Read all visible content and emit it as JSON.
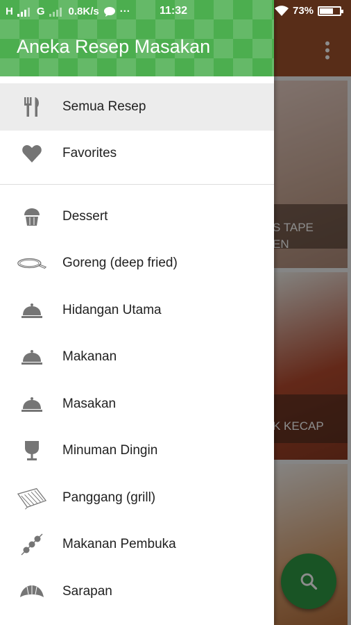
{
  "status_bar": {
    "network": "H",
    "network2": "G",
    "speed": "0.8K/s",
    "more": "···",
    "time": "11:32",
    "battery_level": "73%",
    "battery_fraction": 0.73
  },
  "app": {
    "title": "Aneka Resep Masakan"
  },
  "menu_primary": [
    {
      "label": "Semua Resep",
      "icon": "cutlery-icon"
    },
    {
      "label": "Favorites",
      "icon": "heart-icon"
    }
  ],
  "menu_categories": [
    {
      "label": "Dessert",
      "icon": "cupcake-icon"
    },
    {
      "label": "Goreng (deep fried)",
      "icon": "frying-pan-icon"
    },
    {
      "label": "Hidangan Utama",
      "icon": "cloche-icon"
    },
    {
      "label": "Makanan",
      "icon": "cloche-icon"
    },
    {
      "label": "Masakan",
      "icon": "cloche-icon"
    },
    {
      "label": "Minuman Dingin",
      "icon": "glass-icon"
    },
    {
      "label": "Panggang (grill)",
      "icon": "grill-icon"
    },
    {
      "label": "Makanan Pembuka",
      "icon": "skewer-icon"
    },
    {
      "label": "Sarapan",
      "icon": "croissant-icon"
    }
  ],
  "background": {
    "card1_text_line1": "S TAPE",
    "card1_text_line2": "EN",
    "card2_text": "K KECAP"
  },
  "colors": {
    "header_green": "#4cae4f",
    "fab_green": "#2e9a44",
    "icon_grey": "#757575"
  }
}
